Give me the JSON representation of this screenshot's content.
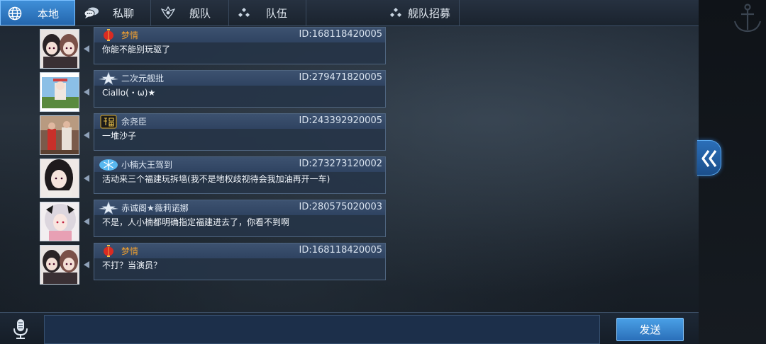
{
  "tabs": [
    {
      "label": "本地",
      "icon": "globe-icon",
      "active": true
    },
    {
      "label": "私聊",
      "icon": "chat-bubbles-icon",
      "active": false
    },
    {
      "label": "舰队",
      "icon": "fleet-emblem-icon",
      "active": false
    },
    {
      "label": "队伍",
      "icon": "team-dots-icon",
      "active": false
    },
    {
      "label": "舰队招募",
      "icon": "recruit-dots-icon",
      "active": false
    }
  ],
  "messages": [
    {
      "name": "梦情",
      "id": "ID:168118420005",
      "text": "你能不能别玩驱了",
      "badge": "lantern-badge-icon",
      "name_color": "#f0a030"
    },
    {
      "name": "二次元舰批",
      "id": "ID:279471820005",
      "text": "Ciallo(・ω)★",
      "badge": "star-wing-badge-icon",
      "name_color": "#dfe8f3"
    },
    {
      "name": "余尧臣",
      "id": "ID:243392920005",
      "text": "一堆沙子",
      "badge": "fu-character-badge-icon",
      "name_color": "#dfe8f3"
    },
    {
      "name": "小楠大王驾到",
      "id": "ID:273273120002",
      "text": "活动来三个福建玩拆墙(我不是地权歧视待会我加油再开一车)",
      "badge": "snowflake-badge-icon",
      "name_color": "#dfe8f3"
    },
    {
      "name": "赤诚阁★薇莉诺娜",
      "id": "ID:280575020003",
      "text": "不是，人小楠都明确指定福建进去了，你看不到啊",
      "badge": "star-wing-badge-icon",
      "name_color": "#dfe8f3"
    },
    {
      "name": "梦情",
      "id": "ID:168118420005",
      "text": "不打？当演员？",
      "badge": "lantern-badge-icon",
      "name_color": "#f0a030"
    }
  ],
  "input": {
    "value": "",
    "placeholder": ""
  },
  "send_label": "发送",
  "colors": {
    "accent": "#2f7fcf",
    "card": "#26344a",
    "orange_name": "#f0a030"
  }
}
